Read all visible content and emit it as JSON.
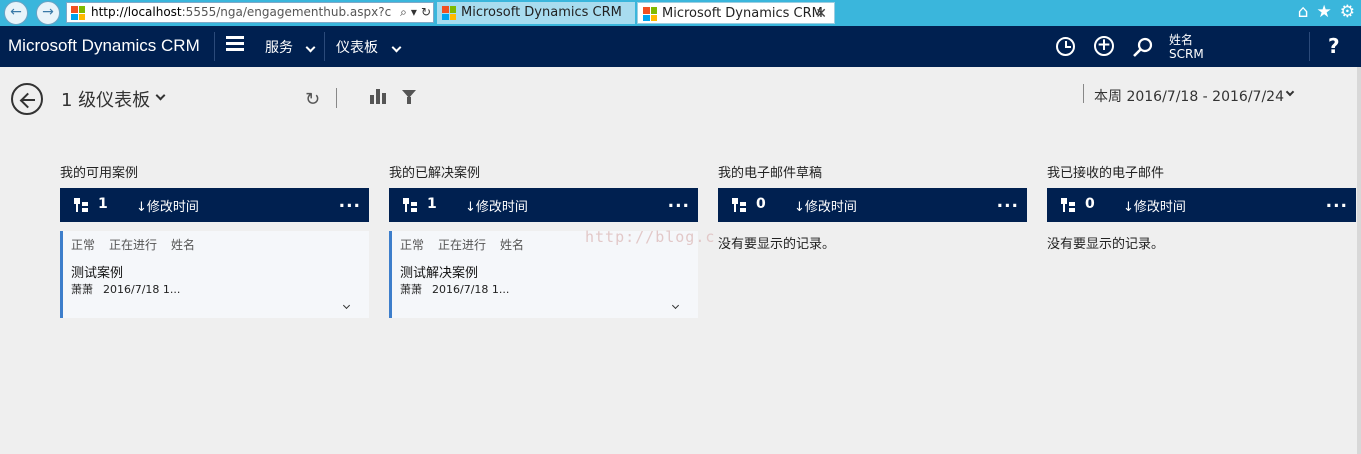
{
  "browser": {
    "url_host": "http://localhost",
    "url_rest": ":5555/nga/engagementhub.aspx?c",
    "tabs": [
      {
        "title": "Microsoft Dynamics CRM",
        "active": false
      },
      {
        "title": "Microsoft Dynamics CRM",
        "active": true
      }
    ],
    "tab_close": "✕"
  },
  "nav": {
    "brand": "Microsoft Dynamics CRM",
    "items": [
      {
        "label": "服务"
      },
      {
        "label": "仪表板"
      }
    ],
    "user": {
      "name": "姓名",
      "org": "SCRM"
    },
    "help": "?"
  },
  "command": {
    "dashboard_title": "1 级仪表板",
    "date_range": "本周 2016/7/18 - 2016/7/24"
  },
  "streams": [
    {
      "title": "我的可用案例",
      "count": "1",
      "sort": "↓修改时间",
      "cards": [
        {
          "tags": [
            "正常",
            "正在进行",
            "姓名"
          ],
          "title": "测试案例",
          "owner": "萧萧",
          "date": "2016/7/18 1..."
        }
      ],
      "empty_message": ""
    },
    {
      "title": "我的已解决案例",
      "count": "1",
      "sort": "↓修改时间",
      "cards": [
        {
          "tags": [
            "正常",
            "正在进行",
            "姓名"
          ],
          "title": "测试解决案例",
          "owner": "萧萧",
          "date": "2016/7/18 1..."
        }
      ],
      "empty_message": ""
    },
    {
      "title": "我的电子邮件草稿",
      "count": "0",
      "sort": "↓修改时间",
      "cards": [],
      "empty_message": "没有要显示的记录。"
    },
    {
      "title": "我已接收的电子邮件",
      "count": "0",
      "sort": "↓修改时间",
      "cards": [],
      "empty_message": "没有要显示的记录。"
    }
  ],
  "more_label": "...",
  "watermark": "http://blog.c",
  "colors": {
    "nav_bg": "#002050",
    "browser_bar": "#3ab6dc",
    "card_accent": "#3d7ecb"
  }
}
